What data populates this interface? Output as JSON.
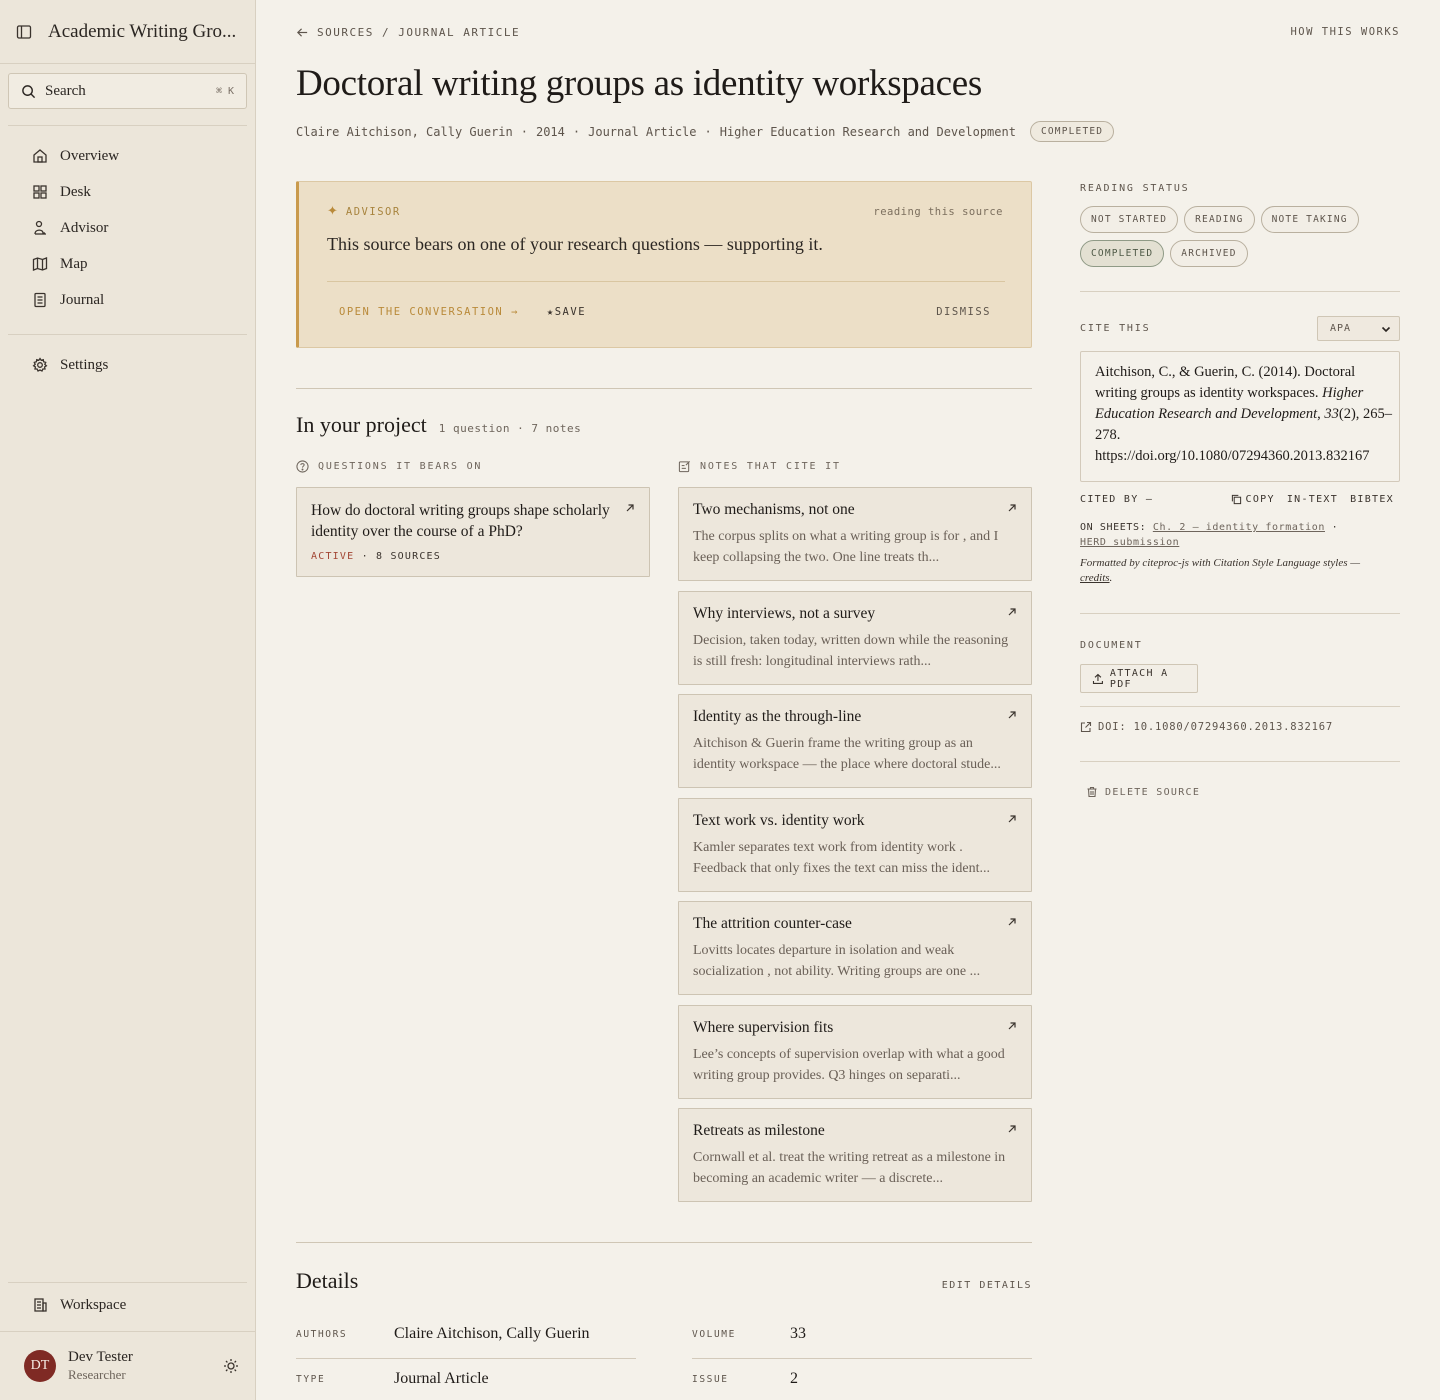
{
  "sidebar": {
    "workspace_title": "Academic Writing Gro...",
    "search": {
      "label": "Search",
      "shortcut": "⌘ K"
    },
    "nav": [
      {
        "label": "Overview",
        "icon": "home-icon"
      },
      {
        "label": "Desk",
        "icon": "grid-icon"
      },
      {
        "label": "Advisor",
        "icon": "advisor-icon"
      },
      {
        "label": "Map",
        "icon": "map-icon"
      },
      {
        "label": "Journal",
        "icon": "journal-icon"
      }
    ],
    "settings_label": "Settings",
    "workspace_label": "Workspace",
    "user": {
      "initials": "DT",
      "name": "Dev Tester",
      "role": "Researcher"
    }
  },
  "header": {
    "breadcrumb": "SOURCES / JOURNAL ARTICLE",
    "how_it_works": "HOW THIS WORKS",
    "title": "Doctoral writing groups as identity workspaces",
    "authors": "Claire Aitchison, Cally Guerin",
    "year": "2014",
    "type": "Journal Article",
    "venue": "Higher Education Research and Development",
    "status_badge": "COMPLETED",
    "separator": "·"
  },
  "advisor": {
    "label": "ADVISOR",
    "context": "reading this source",
    "message": "This source bears on one of your research questions — supporting it.",
    "open_action": "OPEN THE CONVERSATION →",
    "save_action": "★SAVE",
    "dismiss_action": "DISMISS"
  },
  "project": {
    "heading": "In your project",
    "summary": "1 question · 7 notes",
    "questions_label": "QUESTIONS IT BEARS ON",
    "notes_label": "NOTES THAT CITE IT",
    "questions": [
      {
        "text": "How do doctoral writing groups shape scholarly identity over the course of a PhD?",
        "status": "ACTIVE",
        "sources": "· 8 SOURCES"
      }
    ],
    "notes": [
      {
        "title": "Two mechanisms, not one",
        "excerpt": "The corpus splits on what a writing group is for , and I keep collapsing the two. One line treats th..."
      },
      {
        "title": "Why interviews, not a survey",
        "excerpt": "Decision, taken today, written down while the reasoning is still fresh: longitudinal interviews rath..."
      },
      {
        "title": "Identity as the through-line",
        "excerpt": "Aitchison & Guerin frame the writing group as an identity workspace — the place where doctoral stude..."
      },
      {
        "title": "Text work vs. identity work",
        "excerpt": "Kamler separates text work from identity work . Feedback that only fixes the text can miss the ident..."
      },
      {
        "title": "The attrition counter-case",
        "excerpt": "Lovitts locates departure in isolation and weak socialization , not ability. Writing groups are one ..."
      },
      {
        "title": "Where supervision fits",
        "excerpt": "Lee’s concepts of supervision overlap with what a good writing group provides. Q3 hinges on separati..."
      },
      {
        "title": "Retreats as milestone",
        "excerpt": "Cornwall et al. treat the writing retreat as a milestone in becoming an academic writer — a discrete..."
      }
    ]
  },
  "details": {
    "heading": "Details",
    "edit_label": "EDIT DETAILS",
    "rows": [
      {
        "key": "AUTHORS",
        "value": "Claire Aitchison, Cally Guerin"
      },
      {
        "key": "VOLUME",
        "value": "33"
      },
      {
        "key": "TYPE",
        "value": "Journal Article"
      },
      {
        "key": "ISSUE",
        "value": "2"
      }
    ]
  },
  "rail": {
    "reading_status_label": "READING STATUS",
    "statuses": [
      "NOT STARTED",
      "READING",
      "NOTE TAKING",
      "COMPLETED",
      "ARCHIVED"
    ],
    "active_status": "COMPLETED",
    "cite_label": "CITE THIS",
    "cite_style": "APA",
    "citation": {
      "part1": "Aitchison, C., & Guerin, C. (2014). Doctoral writing groups as identity workspaces. ",
      "journal": "Higher Education Research and Development",
      "sep": ", ",
      "volume": "33",
      "rest": "(2), 265–278. https://doi.org/10.1080/07294360.2013.832167"
    },
    "cited_by": "CITED BY —",
    "copy": "COPY",
    "in_text": "IN-TEXT",
    "bibtex": "BIBTEX",
    "on_sheets_label": "ON SHEETS:",
    "sheet_1": "Ch. 2 — identity formation",
    "sheet_sep": " ·",
    "sheet_2": "HERD submission",
    "formatted_note": "Formatted by citeproc-js with Citation Style Language styles — ",
    "credits": "credits",
    "credits_end": ".",
    "document_label": "DOCUMENT",
    "attach_pdf": "ATTACH A PDF",
    "doi": "DOI: 10.1080/07294360.2013.832167",
    "delete": "DELETE SOURCE"
  }
}
